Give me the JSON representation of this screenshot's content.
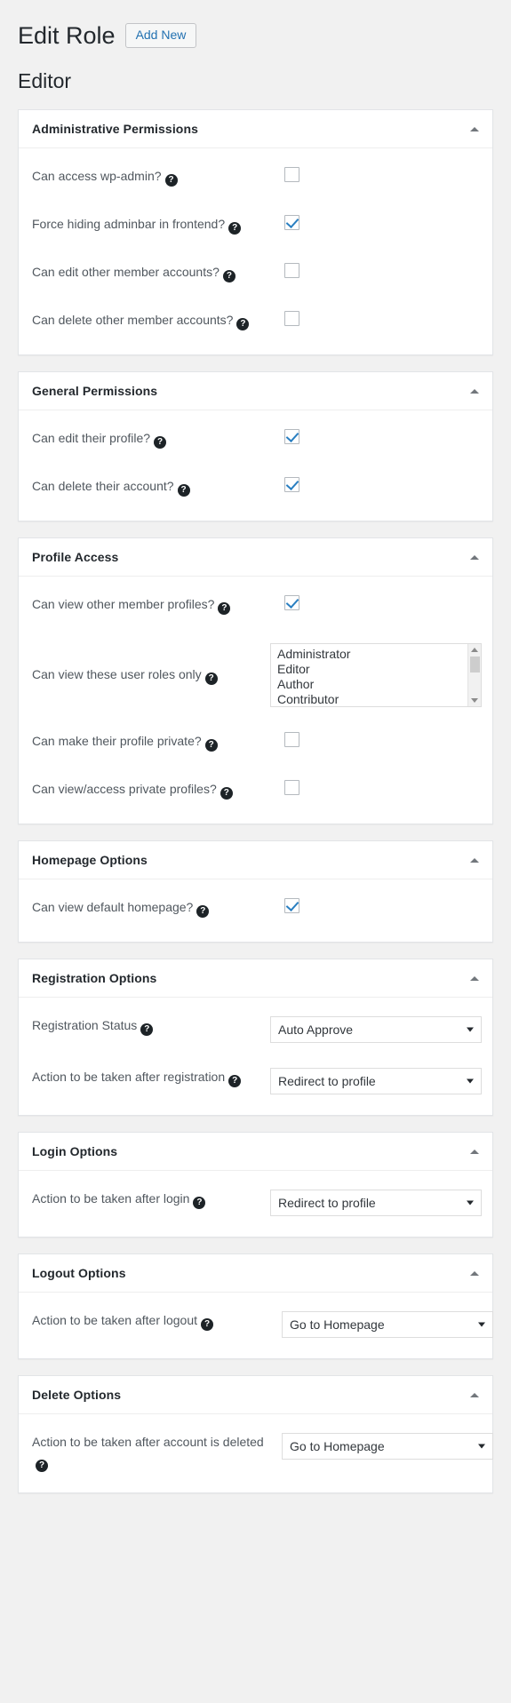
{
  "header": {
    "title": "Edit Role",
    "add_new_label": "Add New",
    "role_name": "Editor"
  },
  "icons": {
    "help": "?",
    "collapse": "collapse-arrow",
    "caret": "chevron-down"
  },
  "panels": [
    {
      "id": "administrative-permissions",
      "title": "Administrative Permissions",
      "rows": [
        {
          "label": "Can access wp-admin?",
          "type": "checkbox",
          "checked": false
        },
        {
          "label": "Force hiding adminbar in frontend?",
          "type": "checkbox",
          "checked": true
        },
        {
          "label": "Can edit other member accounts?",
          "type": "checkbox",
          "checked": false
        },
        {
          "label": "Can delete other member accounts?",
          "type": "checkbox",
          "checked": false
        }
      ]
    },
    {
      "id": "general-permissions",
      "title": "General Permissions",
      "rows": [
        {
          "label": "Can edit their profile?",
          "type": "checkbox",
          "checked": true
        },
        {
          "label": "Can delete their account?",
          "type": "checkbox",
          "checked": true
        }
      ]
    },
    {
      "id": "profile-access",
      "title": "Profile Access",
      "rows": [
        {
          "label": "Can view other member profiles?",
          "type": "checkbox",
          "checked": true
        },
        {
          "label": "Can view these user roles only",
          "type": "listbox",
          "options": [
            "Administrator",
            "Editor",
            "Author",
            "Contributor"
          ]
        },
        {
          "label": "Can make their profile private?",
          "type": "checkbox",
          "checked": false
        },
        {
          "label": "Can view/access private profiles?",
          "type": "checkbox",
          "checked": false
        }
      ]
    },
    {
      "id": "homepage-options",
      "title": "Homepage Options",
      "rows": [
        {
          "label": "Can view default homepage?",
          "type": "checkbox",
          "checked": true
        }
      ]
    },
    {
      "id": "registration-options",
      "title": "Registration Options",
      "rows": [
        {
          "label": "Registration Status",
          "type": "select",
          "value": "Auto Approve"
        },
        {
          "label": "Action to be taken after registration",
          "type": "select",
          "value": "Redirect to profile"
        }
      ]
    },
    {
      "id": "login-options",
      "title": "Login Options",
      "rows": [
        {
          "label": "Action to be taken after login",
          "type": "select",
          "value": "Redirect to profile"
        }
      ]
    },
    {
      "id": "logout-options",
      "title": "Logout Options",
      "rows": [
        {
          "label": "Action to be taken after logout",
          "type": "select",
          "value": "Go to Homepage",
          "offset": true
        }
      ]
    },
    {
      "id": "delete-options",
      "title": "Delete Options",
      "rows": [
        {
          "label": "Action to be taken after account is deleted",
          "type": "select",
          "value": "Go to Homepage",
          "offset": true
        }
      ]
    }
  ]
}
